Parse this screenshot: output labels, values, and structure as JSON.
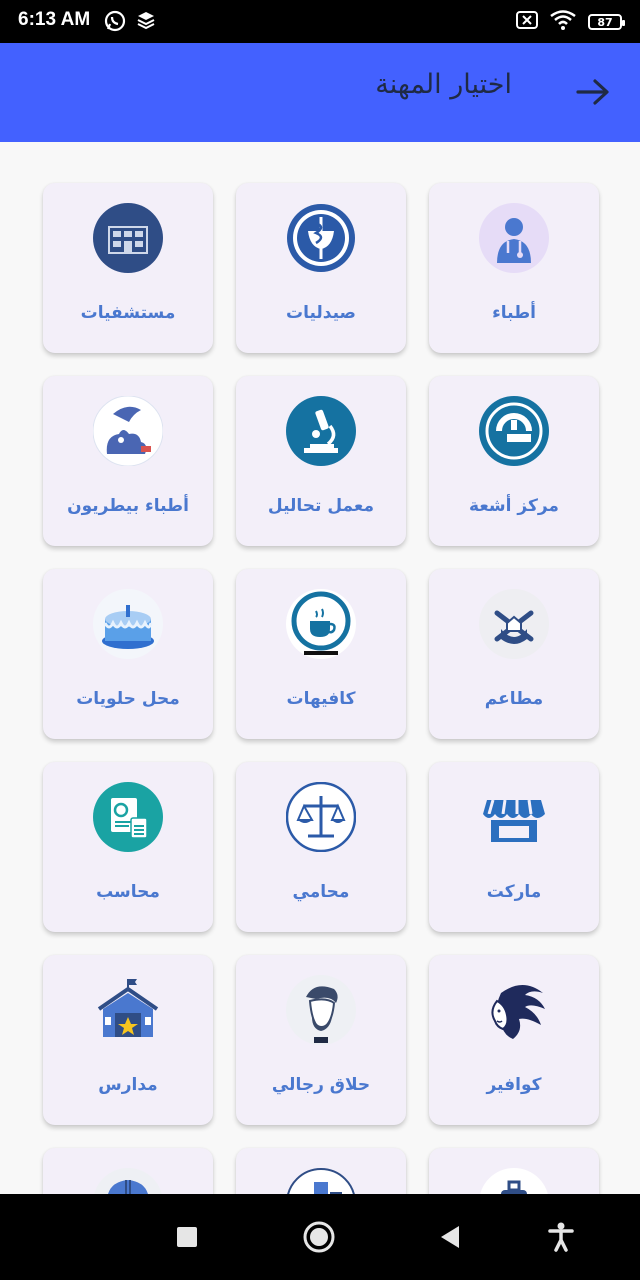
{
  "status_bar": {
    "time": "6:13 AM",
    "battery": "87",
    "icons": [
      "whatsapp-icon",
      "layers-icon",
      "sim-blocked-icon",
      "wifi-icon",
      "battery-icon"
    ]
  },
  "app_bar": {
    "title": "اختيار المهنة",
    "back_icon": "arrow-right-icon",
    "color": "#4361ff"
  },
  "professions": [
    {
      "label": "أطباء",
      "icon": "doctor-icon"
    },
    {
      "label": "صيدليات",
      "icon": "pharmacy-caduceus-icon"
    },
    {
      "label": "مستشفيات",
      "icon": "hospital-building-icon"
    },
    {
      "label": "مركز أشعة",
      "icon": "mri-scanner-icon"
    },
    {
      "label": "معمل تحاليل",
      "icon": "microscope-icon"
    },
    {
      "label": "أطباء بيطريون",
      "icon": "pets-icon"
    },
    {
      "label": "مطاعم",
      "icon": "restaurant-utensils-icon"
    },
    {
      "label": "كافيهات",
      "icon": "coffee-cup-icon"
    },
    {
      "label": "محل حلويات",
      "icon": "cake-icon"
    },
    {
      "label": "ماركت",
      "icon": "market-store-icon"
    },
    {
      "label": "محامي",
      "icon": "scales-of-justice-icon"
    },
    {
      "label": "محاسب",
      "icon": "accounting-calculator-icon"
    },
    {
      "label": "كوافير",
      "icon": "woman-hair-icon"
    },
    {
      "label": "حلاق رجالي",
      "icon": "barber-man-icon"
    },
    {
      "label": "مدارس",
      "icon": "school-building-icon"
    },
    {
      "label": "",
      "icon": "luggage-icon"
    },
    {
      "label": "",
      "icon": "city-buildings-icon"
    },
    {
      "label": "",
      "icon": "worker-helmet-icon"
    }
  ],
  "nav_bar": {
    "icons": [
      "recent-apps-icon",
      "home-icon",
      "back-icon",
      "accessibility-icon"
    ]
  },
  "colors": {
    "accent": "#4361ff",
    "label": "#4a78cf",
    "card": "#f3eff9"
  }
}
